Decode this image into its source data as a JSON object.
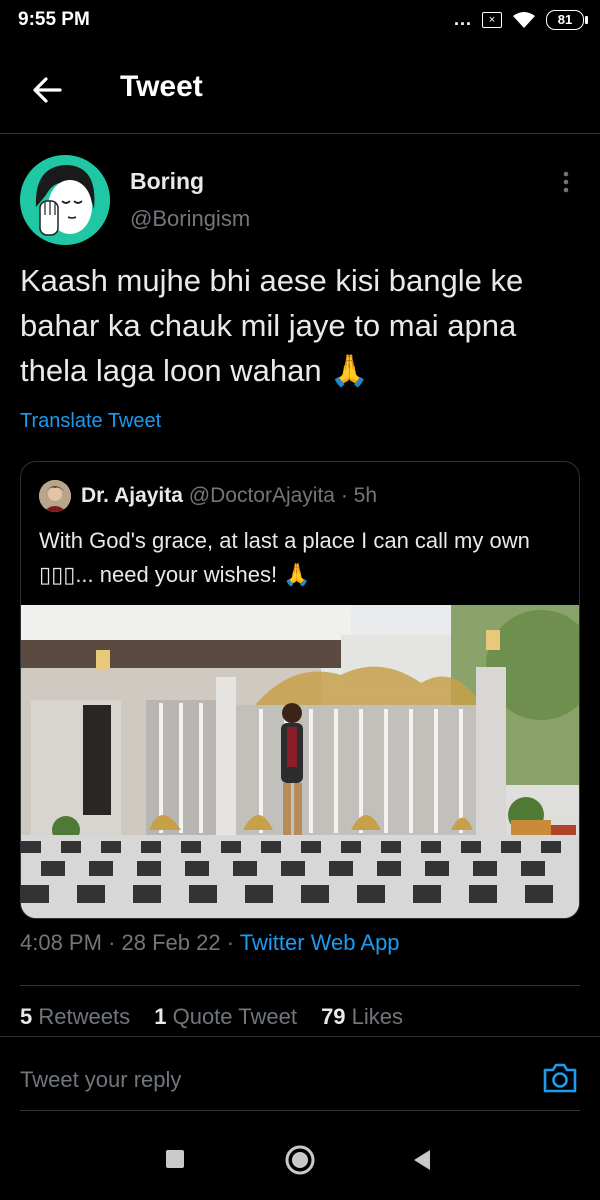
{
  "status_bar": {
    "time": "9:55 PM",
    "dots": "...",
    "notification_badge": "×",
    "battery": "81"
  },
  "header": {
    "title": "Tweet",
    "back_icon": "arrow-left-icon"
  },
  "tweet": {
    "author_name": "Boring",
    "author_handle": "@Boringism",
    "text": "Kaash mujhe bhi aese kisi bangle ke bahar ka chauk mil jaye to mai apna thela laga loon wahan 🙏",
    "translate_label": "Translate Tweet",
    "time": "4:08 PM",
    "sep1": "·",
    "date": "28 Feb 22",
    "sep2": "·",
    "source": "Twitter Web App"
  },
  "quote": {
    "name": "Dr. Ajayita",
    "handle": "@DoctorAjayita",
    "sep": "·",
    "time": "5h",
    "text": "With God's grace, at last a place I can call my own ▯▯▯... need your wishes! 🙏"
  },
  "stats": {
    "retweets_count": "5",
    "retweets_label": "Retweets",
    "quotes_count": "1",
    "quotes_label": "Quote Tweet",
    "likes_count": "79",
    "likes_label": "Likes"
  },
  "reply": {
    "placeholder": "Tweet your reply"
  },
  "colors": {
    "accent": "#1d9bf0",
    "background": "#000000",
    "secondary_text": "#71767b",
    "divider": "#2f3336",
    "avatar_bg": "#1fc7a4"
  }
}
